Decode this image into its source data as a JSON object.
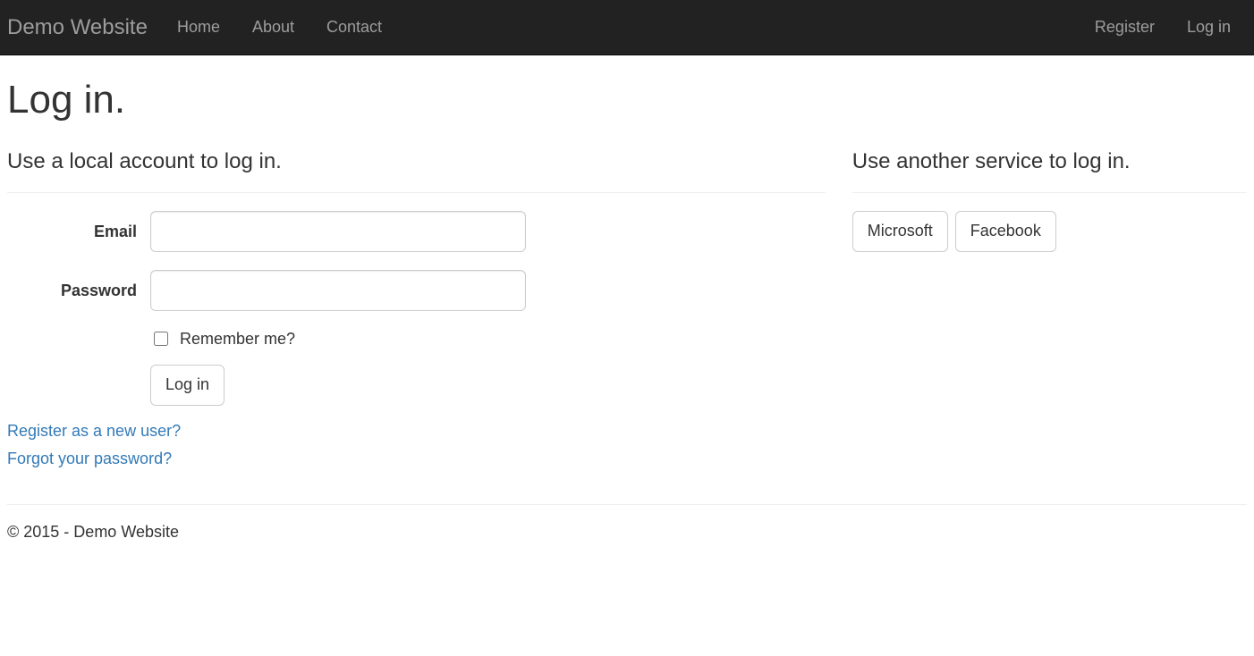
{
  "navbar": {
    "brand": "Demo Website",
    "left": [
      {
        "label": "Home"
      },
      {
        "label": "About"
      },
      {
        "label": "Contact"
      }
    ],
    "right": [
      {
        "label": "Register"
      },
      {
        "label": "Log in"
      }
    ]
  },
  "page": {
    "title": "Log in."
  },
  "local": {
    "heading": "Use a local account to log in.",
    "email_label": "Email",
    "password_label": "Password",
    "remember_label": "Remember me?",
    "submit_label": "Log in",
    "register_link": "Register as a new user?",
    "forgot_link": "Forgot your password?"
  },
  "external": {
    "heading": "Use another service to log in.",
    "providers": [
      {
        "label": "Microsoft"
      },
      {
        "label": "Facebook"
      }
    ]
  },
  "footer": {
    "text": "© 2015 - Demo Website"
  }
}
